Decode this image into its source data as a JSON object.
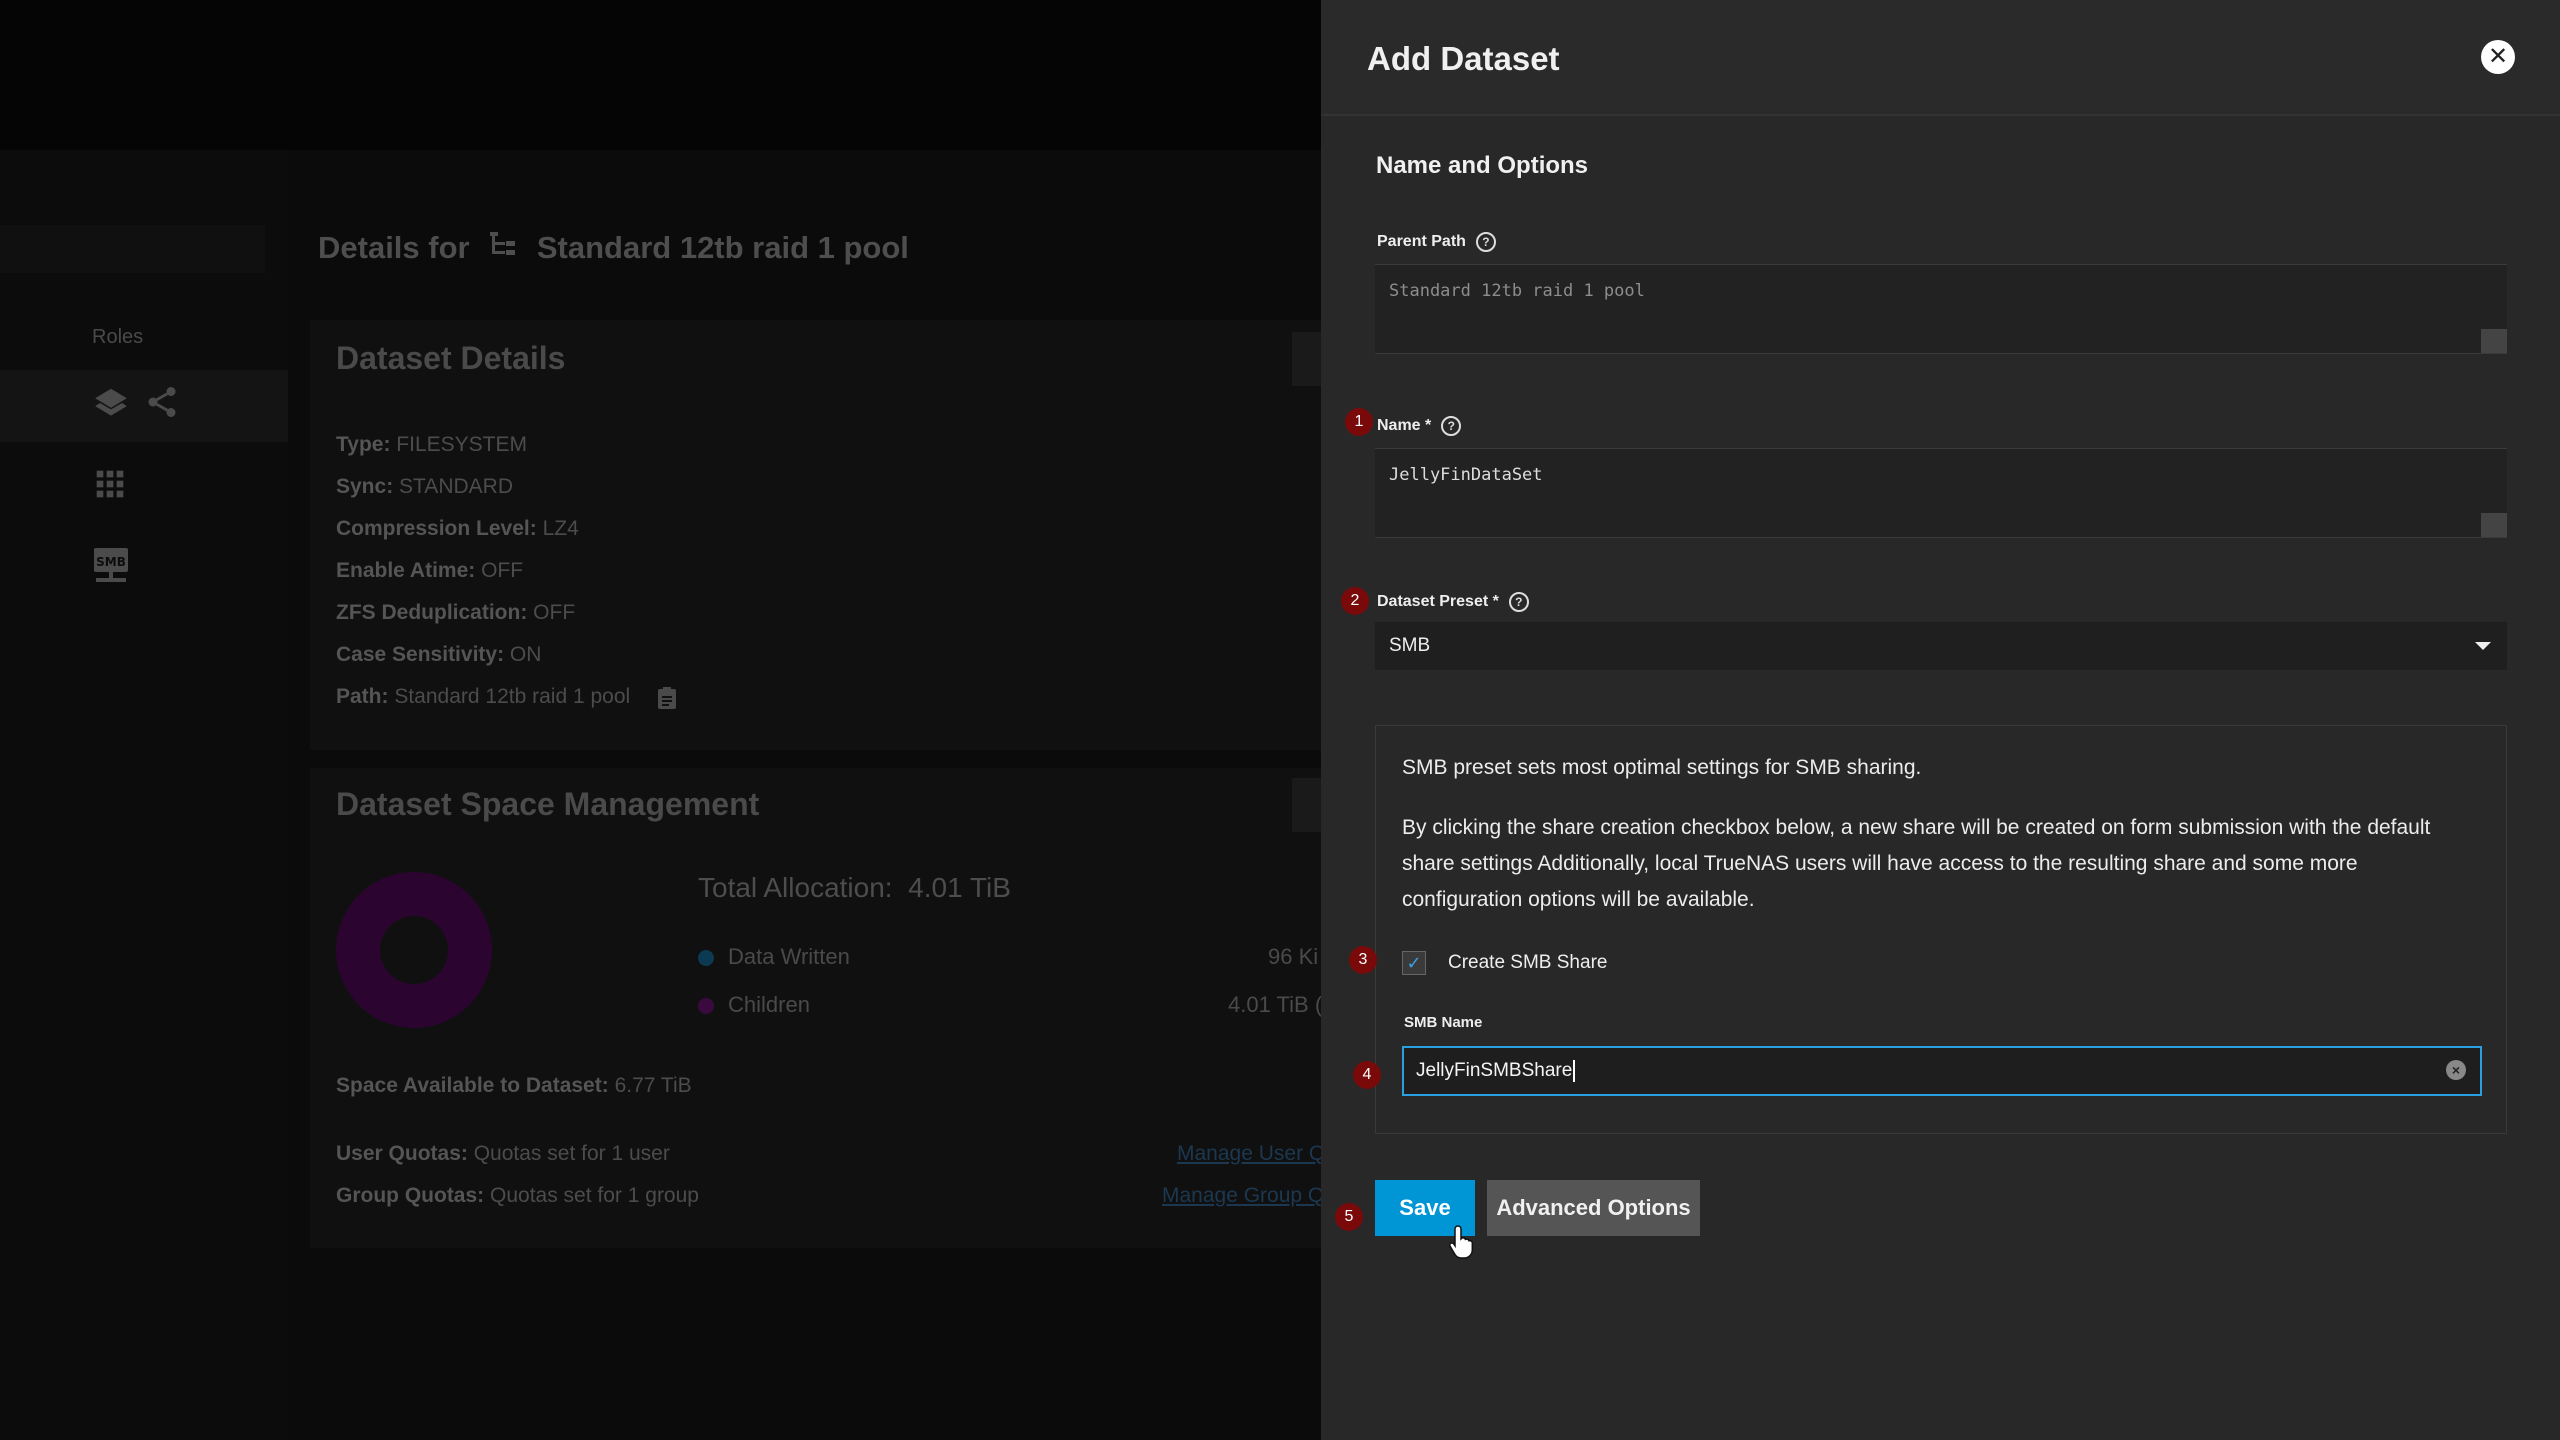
{
  "background": {
    "roles_label": "Roles",
    "details_prefix": "Details for",
    "pool_name": "Standard 12tb raid 1 pool",
    "dataset_details": {
      "title": "Dataset Details",
      "rows": [
        {
          "label": "Type:",
          "value": "FILESYSTEM"
        },
        {
          "label": "Sync:",
          "value": "STANDARD"
        },
        {
          "label": "Compression Level:",
          "value": "LZ4"
        },
        {
          "label": "Enable Atime:",
          "value": "OFF"
        },
        {
          "label": "ZFS Deduplication:",
          "value": "OFF"
        },
        {
          "label": "Case Sensitivity:",
          "value": "ON"
        },
        {
          "label": "Path:",
          "value": "Standard 12tb raid 1 pool"
        }
      ]
    },
    "space_management": {
      "title": "Dataset Space Management",
      "total_label": "Total Allocation:",
      "total_value": "4.01 TiB",
      "legend": [
        {
          "name": "Data Written",
          "value": "96 Ki",
          "color": "#0b3a52"
        },
        {
          "name": "Children",
          "value": "4.01 TiB (",
          "color": "#3a0a3e"
        }
      ],
      "space_available_label": "Space Available to Dataset:",
      "space_available_value": "6.77 TiB",
      "user_quotas_label": "User Quotas:",
      "user_quotas_value": "Quotas set for 1 user",
      "group_quotas_label": "Group Quotas:",
      "group_quotas_value": "Quotas set for 1 group",
      "manage_user_link": "Manage User Q",
      "manage_group_link": "Manage Group Q"
    },
    "smb_icon_text": "SMB"
  },
  "panel": {
    "title": "Add Dataset",
    "close_glyph": "✕",
    "section_title": "Name and Options",
    "parent_path": {
      "label": "Parent Path",
      "value": "Standard 12tb raid 1 pool"
    },
    "name": {
      "label": "Name *",
      "value": "JellyFinDataSet"
    },
    "preset": {
      "label": "Dataset Preset *",
      "value": "SMB"
    },
    "preset_info": {
      "line1": "SMB preset sets most optimal settings for SMB sharing.",
      "line2": "By clicking the share creation checkbox below, a new share will be created on form submission with the default share settings Additionally, local TrueNAS users will have access to the resulting share and some more configuration options will be available."
    },
    "create_smb": {
      "label": "Create SMB Share",
      "checked": true
    },
    "smb_name": {
      "label": "SMB Name",
      "value": "JellyFinSMBShare"
    },
    "save_label": "Save",
    "advanced_label": "Advanced Options",
    "help_glyph": "?"
  },
  "steps": [
    "1",
    "2",
    "3",
    "4",
    "5"
  ],
  "colors": {
    "accent": "#0095d5",
    "step_badge": "#7a0a0a"
  }
}
